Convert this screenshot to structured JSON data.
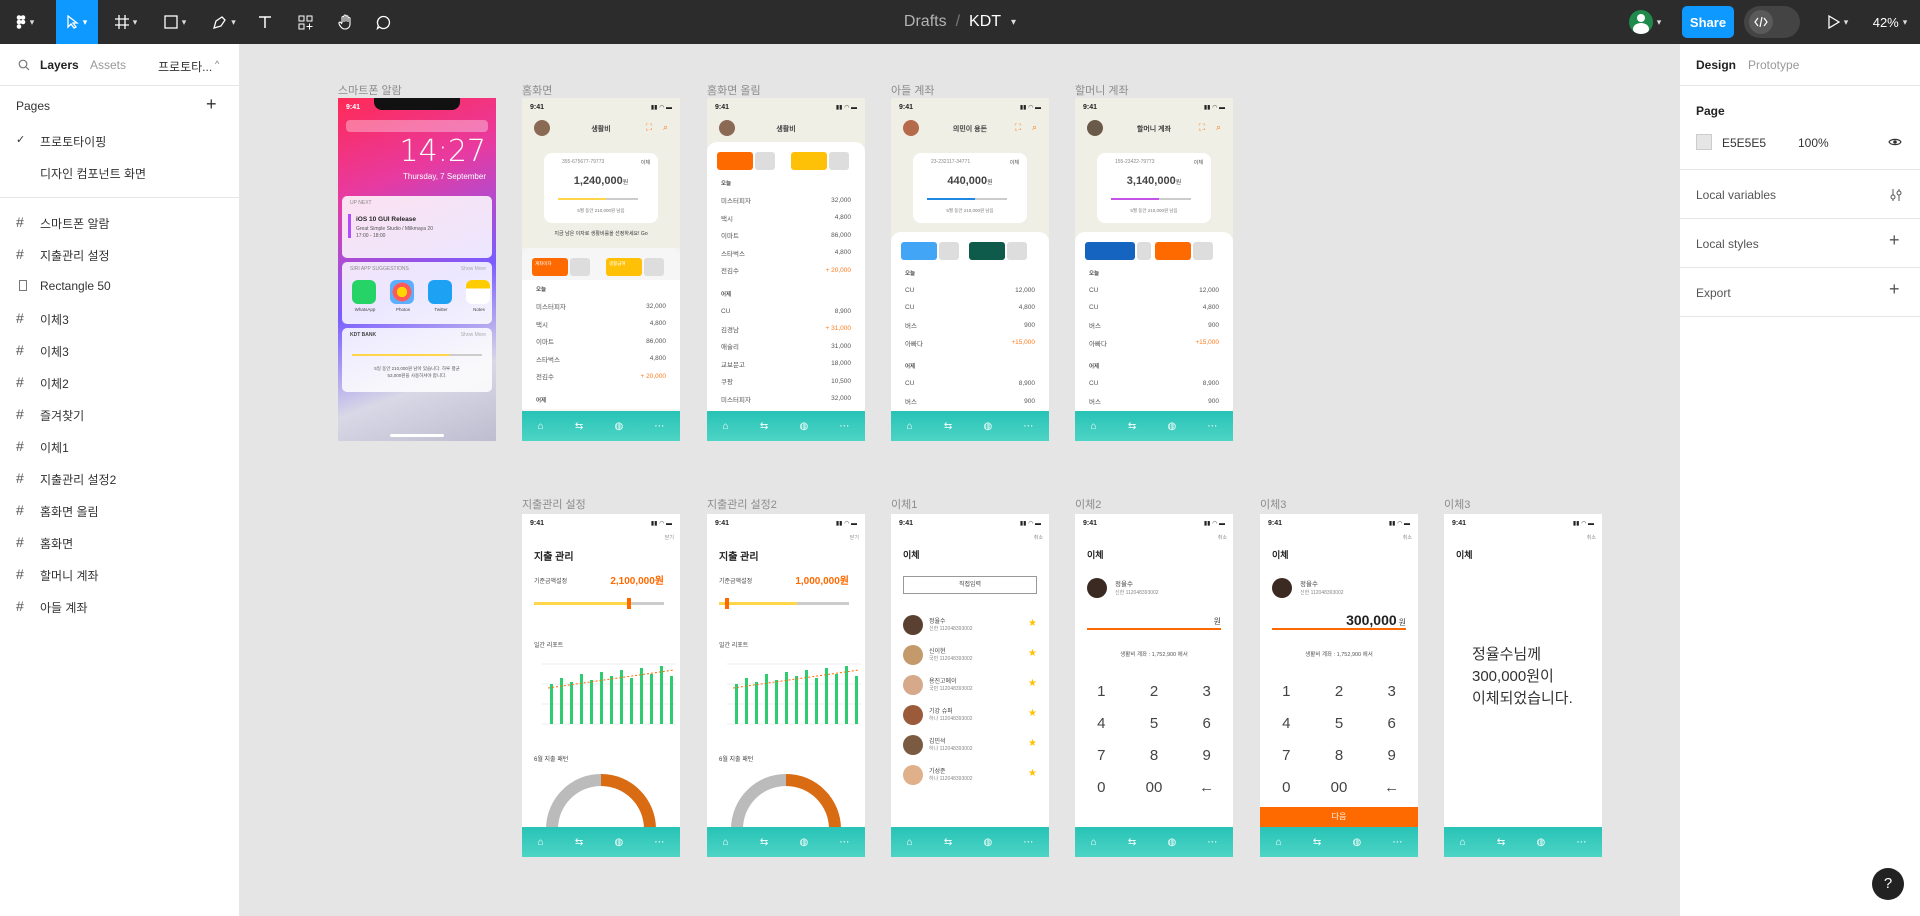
{
  "toolbar": {
    "breadcrumb_parent": "Drafts",
    "breadcrumb_sep": "/",
    "file_name": "KDT",
    "share_label": "Share",
    "zoom": "42%",
    "avatar_initial": ""
  },
  "left": {
    "tab_layers": "Layers",
    "tab_assets": "Assets",
    "tab_page": "프로토타...",
    "pages_heading": "Pages",
    "pages": [
      {
        "label": "프로토타이핑",
        "current": true
      },
      {
        "label": "디자인 컴포넌트 화면",
        "current": false
      }
    ],
    "layers": [
      "스마트폰 알람",
      "지출관리 설정",
      "Rectangle 50",
      "이체3",
      "이체3",
      "이체2",
      "즐겨찾기",
      "이체1",
      "지출관리 설정2",
      "홈화면 올림",
      "홈화면",
      "할머니 계좌",
      "아들 계좌"
    ]
  },
  "right": {
    "tab_design": "Design",
    "tab_prototype": "Prototype",
    "page_heading": "Page",
    "page_color": "E5E5E5",
    "page_opacity": "100%",
    "local_variables": "Local variables",
    "local_styles": "Local styles",
    "export": "Export"
  },
  "frames": {
    "alarm": {
      "label": "스마트폰 알람",
      "time": "14:27",
      "date": "Thursday, 7 September",
      "status_time": "9:41",
      "notif_app": "UP NEXT",
      "notif_title": "iOS 10 GUI Release",
      "notif_sub": "Great Simple Studio / Milkmaya 20",
      "notif_time": "17:00 - 18:00",
      "siri": "SIRI APP SUGGESTIONS",
      "show_more": "Show More",
      "apps": [
        "WhatsApp",
        "Photos",
        "Twitter",
        "Notes"
      ],
      "bank": "KDT BANK",
      "bank_text1": "5일 동안 210,000원 남아 있습니다. 하루 평균",
      "bank_text2": "53,000원을 사용하셔야 합니다."
    },
    "home": {
      "label": "홈화면",
      "status_time": "9:41",
      "name": "생활비",
      "account": "355-675677-79773",
      "transfer": "이체",
      "balance": "1,240,000",
      "won": "원",
      "remain": "5월 동안 210,000원 남음",
      "hint": "지금 남은 이자로 생활비를을 선정하세요! Go",
      "pill1": "계좌이자",
      "pill2": "생활급여",
      "today": "오늘",
      "rows": [
        [
          "미스터피자",
          "32,000"
        ],
        [
          "택시",
          "4,800"
        ],
        [
          "이마트",
          "86,000"
        ],
        [
          "스타벅스",
          "4,800"
        ],
        [
          "전김수",
          "+ 20,000"
        ]
      ],
      "yesterday": "어제"
    },
    "home_up": {
      "label": "홈화면 올림",
      "status_time": "9:41",
      "name": "생활비",
      "today": "오늘",
      "rows": [
        [
          "미스터피자",
          "32,000"
        ],
        [
          "택시",
          "4,800"
        ],
        [
          "이마트",
          "86,000"
        ],
        [
          "스타벅스",
          "4,800"
        ],
        [
          "전김수",
          "+ 20,000"
        ]
      ],
      "yesterday": "어제",
      "rows2": [
        [
          "CU",
          "8,900"
        ],
        [
          "김경남",
          "+ 31,000"
        ],
        [
          "애슐리",
          "31,000"
        ],
        [
          "교보문고",
          "18,000"
        ],
        [
          "쿠팡",
          "10,500"
        ],
        [
          "미스터피자",
          "32,000"
        ]
      ]
    },
    "son": {
      "label": "아들 계좌",
      "status_time": "9:41",
      "name": "의민이 용돈",
      "account": "23-232117-34771",
      "transfer": "이체",
      "balance": "440,000",
      "won": "원",
      "remain": "5월 동안 210,000원 남음",
      "today": "오늘",
      "rows": [
        [
          "CU",
          "12,000"
        ],
        [
          "CU",
          "4,800"
        ],
        [
          "버스",
          "900"
        ],
        [
          "아빠다",
          "+15,000"
        ]
      ],
      "yesterday": "어제",
      "rows2": [
        [
          "CU",
          "8,900"
        ],
        [
          "버스",
          "900"
        ]
      ]
    },
    "grandma": {
      "label": "할머니 계좌",
      "status_time": "9:41",
      "name": "할머니 계좌",
      "account": "155-23422-79773",
      "transfer": "이체",
      "balance": "3,140,000",
      "won": "원",
      "remain": "5월 동안 210,000원 남음",
      "today": "오늘",
      "rows": [
        [
          "CU",
          "12,000"
        ],
        [
          "CU",
          "4,800"
        ],
        [
          "버스",
          "900"
        ],
        [
          "아빠다",
          "+15,000"
        ]
      ],
      "yesterday": "어제",
      "rows2": [
        [
          "CU",
          "8,900"
        ],
        [
          "버스",
          "900"
        ]
      ]
    },
    "budget1": {
      "label": "지출관리 설정",
      "status_time": "9:41",
      "title": "지출 관리",
      "setting": "기준금액설정",
      "amount": "2,100,000원",
      "weekly": "일간 리포트",
      "monthly": "6월 지출 패턴",
      "close": "닫기"
    },
    "budget2": {
      "label": "지출관리 설정2",
      "status_time": "9:41",
      "title": "지출 관리",
      "setting": "기준금액설정",
      "amount": "1,000,000원",
      "weekly": "일간 리포트",
      "monthly": "6월 지출 패턴",
      "close": "닫기"
    },
    "transfer1": {
      "label": "이체1",
      "status_time": "9:41",
      "title": "이체",
      "direct": "직접입력",
      "cancel": "취소",
      "contacts": [
        [
          "정율수",
          "신한 112048393002"
        ],
        [
          "신이현",
          "국민 112048393002"
        ],
        [
          "용진고메이",
          "국민 112048393002"
        ],
        [
          "기강 슈퍼",
          "하나 112048393002"
        ],
        [
          "김민석",
          "하나 112048393002"
        ],
        [
          "기성준",
          "하나 112048393002"
        ]
      ]
    },
    "transfer2": {
      "label": "이체2",
      "status_time": "9:41",
      "title": "이체",
      "name": "정율수",
      "bank": "신한 112048393002",
      "won": "원",
      "from": "생활비 계좌 : 1,752,900 에서",
      "cancel": "취소",
      "keys": [
        "1",
        "2",
        "3",
        "4",
        "5",
        "6",
        "7",
        "8",
        "9",
        "0",
        "00",
        "←"
      ]
    },
    "transfer3": {
      "label": "이체3",
      "status_time": "9:41",
      "title": "이체",
      "name": "정율수",
      "bank": "신한 112048393002",
      "amount": "300,000",
      "won": "원",
      "from": "생활비 계좌 : 1,752,900 에서",
      "next": "다음",
      "cancel": "취소",
      "keys": [
        "1",
        "2",
        "3",
        "4",
        "5",
        "6",
        "7",
        "8",
        "9",
        "0",
        "00",
        "←"
      ]
    },
    "transfer4": {
      "label": "이체3",
      "status_time": "9:41",
      "title": "이체",
      "done1": "정율수님께",
      "done2": "300,000원이",
      "done3": "이체되었습니다.",
      "cancel": "취소"
    }
  },
  "colors": {
    "accent": "#0d99ff",
    "teal": "#2ec4b6",
    "orange": "#ff6a00",
    "canvas": "#E5E5E5"
  }
}
